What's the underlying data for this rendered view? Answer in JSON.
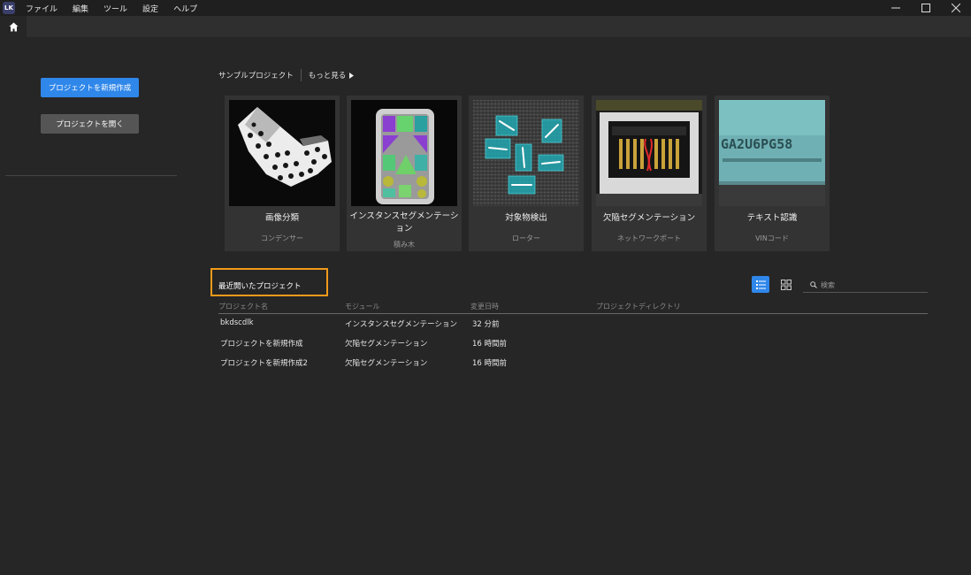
{
  "app": {
    "logo_text": "LK"
  },
  "menu": [
    "ファイル",
    "編集",
    "ツール",
    "設定",
    "ヘルプ"
  ],
  "left_panel": {
    "new_project_label": "プロジェクトを新規作成",
    "open_project_label": "プロジェクトを開く"
  },
  "samples": {
    "header": "サンプルプロジェクト",
    "more_label": "もっと見る",
    "cards": [
      {
        "title": "画像分類",
        "subtitle": "コンデンサー"
      },
      {
        "title": "インスタンスセグメンテーション",
        "subtitle": "積み木"
      },
      {
        "title": "対象物検出",
        "subtitle": "ローター"
      },
      {
        "title": "欠陥セグメンテーション",
        "subtitle": "ネットワークポート"
      },
      {
        "title": "テキスト認識",
        "subtitle": "VINコード"
      }
    ],
    "ocr_text": "GA2U6PG58"
  },
  "recent": {
    "title": "最近開いたプロジェクト",
    "search_placeholder": "検索",
    "columns": [
      "プロジェクト名",
      "モジュール",
      "変更日時",
      "プロジェクトディレクトリ"
    ],
    "rows": [
      {
        "name": "bkdscdlk",
        "module": "インスタンスセグメンテーション",
        "modified": "32 分前",
        "directory": ""
      },
      {
        "name": "プロジェクトを新規作成",
        "module": "欠陥セグメンテーション",
        "modified": "16 時間前",
        "directory": ""
      },
      {
        "name": "プロジェクトを新規作成2",
        "module": "欠陥セグメンテーション",
        "modified": "16 時間前",
        "directory": ""
      }
    ]
  },
  "colors": {
    "accent": "#2f87ea",
    "highlight": "#f29a1a",
    "background": "#262626"
  }
}
